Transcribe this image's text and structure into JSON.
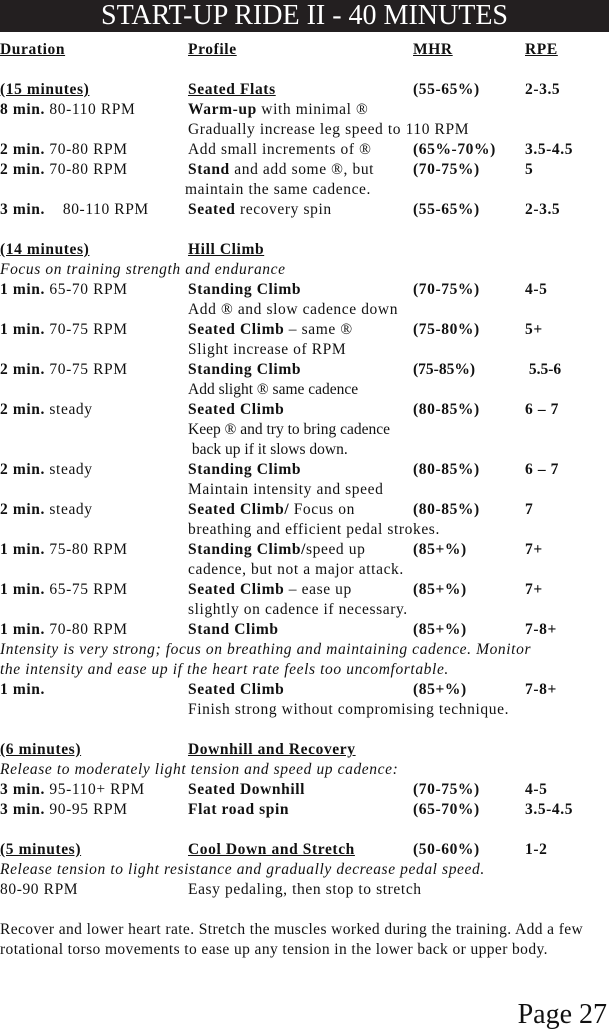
{
  "title": "START-UP RIDE II - 40 MINUTES",
  "headers": {
    "duration": "Duration",
    "profile": "Profile",
    "mhr": "MHR",
    "rpe": "RPE"
  },
  "sections": [
    {
      "duration": "(15 minutes)",
      "profile": "Seated Flats",
      "mhr": "(55-65%)",
      "rpe": "2-3.5",
      "rows": [
        {
          "dur_bold": "8 min.",
          "dur": " 80-110 RPM",
          "prof_bold": "Warm-up",
          "prof": " with minimal ®",
          "mhr": "",
          "rpe": "",
          "note": "Gradually increase leg speed to 110 RPM"
        },
        {
          "dur_bold": "2 min.",
          "dur": " 70-80 RPM",
          "prof_bold": "",
          "prof": "Add small increments of ®",
          "mhr": "(65%-70%)",
          "rpe": "3.5-4.5",
          "note": ""
        },
        {
          "dur_bold": "2 min.",
          "dur": " 70-80 RPM",
          "prof_bold": "Stand",
          "prof": " and add some ®, but",
          "mhr": "(70-75%)",
          "rpe": "5",
          "note": "maintain the same cadence."
        },
        {
          "dur_bold": "3 min.",
          "dur": "    80-110 RPM",
          "prof_bold": "Seated",
          "prof": " recovery spin",
          "mhr": "(55-65%)",
          "rpe": "2-3.5",
          "note": ""
        }
      ]
    },
    {
      "duration": "(14 minutes)",
      "profile": "Hill Climb",
      "intro": "Focus on training strength and endurance",
      "rows": [
        {
          "dur_bold": "1 min.",
          "dur": " 65-70 RPM",
          "prof_bold": "Standing Climb",
          "prof": "",
          "mhr": "(70-75%)",
          "rpe": "4-5",
          "note": "Add ® and slow cadence down"
        },
        {
          "dur_bold": "1 min.",
          "dur": " 70-75 RPM",
          "prof_bold": "Seated Climb",
          "prof": " – same ®",
          "mhr": "(75-80%)",
          "rpe": "5+",
          "note": "Slight increase of RPM"
        },
        {
          "dur_bold": "2 min.",
          "dur": " 70-75 RPM",
          "prof_bold": "Standing Climb",
          "prof": "",
          "mhr": "(75-85%)",
          "rpe": " 5.5-6",
          "note": "Add slight ® same cadence"
        },
        {
          "dur_bold": "2 min.",
          "dur": " steady",
          "prof_bold": "Seated Climb",
          "prof": "",
          "mhr": "(80-85%)",
          "rpe": "6 – 7",
          "note": "Keep ® and try to bring cadence",
          "note2": " back up if it slows down."
        },
        {
          "dur_bold": "2 min.",
          "dur": " steady",
          "prof_bold": "Standing Climb",
          "prof": "",
          "mhr": "(80-85%)",
          "rpe": "6 – 7",
          "note": "Maintain intensity and speed"
        },
        {
          "dur_bold": "2 min.",
          "dur": " steady",
          "prof_bold": "Seated Climb/",
          "prof": " Focus on",
          "mhr": "(80-85%)",
          "rpe": "7",
          "note": "breathing and efficient pedal strokes."
        },
        {
          "dur_bold": "1 min.",
          "dur": " 75-80 RPM",
          "prof_bold": "Standing Climb/",
          "prof": "speed up",
          "mhr": "(85+%)",
          "rpe": "7+",
          "note": "cadence, but not a major attack."
        },
        {
          "dur_bold": "1 min.",
          "dur": " 65-75 RPM",
          "prof_bold": "Seated Climb",
          "prof": " – ease up",
          "mhr": "(85+%)",
          "rpe": "7+",
          "note": "slightly on cadence if necessary."
        },
        {
          "dur_bold": "1 min.",
          "dur": " 70-80 RPM",
          "prof_bold": "Stand Climb",
          "prof": "",
          "mhr": "(85+%)",
          "rpe": "7-8+",
          "note": ""
        }
      ],
      "outro": [
        "Intensity is very strong; focus on breathing and maintaining cadence. Monitor",
        "the intensity and ease up if the heart rate feels too uncomfortable."
      ],
      "final_row": {
        "dur_bold": "1 min.",
        "prof_bold": "Seated Climb",
        "mhr": "(85+%)",
        "rpe": "7-8+",
        "note": "Finish strong without compromising technique."
      }
    },
    {
      "duration": "(6 minutes)",
      "profile": "Downhill and Recovery",
      "intro": "Release to moderately light tension and speed up cadence:",
      "rows": [
        {
          "dur_bold": "3 min.",
          "dur": " 95-110+ RPM",
          "prof_bold": "Seated Downhill",
          "mhr": "(70-75%)",
          "rpe": "4-5"
        },
        {
          "dur_bold": "3 min.",
          "dur": " 90-95 RPM",
          "prof_bold": "Flat road spin",
          "mhr": "(65-70%)",
          "rpe": "3.5-4.5"
        }
      ]
    },
    {
      "duration": "(5 minutes)",
      "profile": "Cool Down and Stretch",
      "mhr": "(50-60%)",
      "rpe": "1-2",
      "intro": "Release tension to light resistance and gradually decrease pedal speed.",
      "rows": [
        {
          "dur": "80-90 RPM",
          "prof": "Easy pedaling, then stop to stretch"
        }
      ],
      "closing": "Recover and lower heart rate. Stretch the muscles worked during the training. Add a few rotational torso movements to ease up any tension in the lower back or upper body."
    }
  ],
  "page_number": "Page 27"
}
